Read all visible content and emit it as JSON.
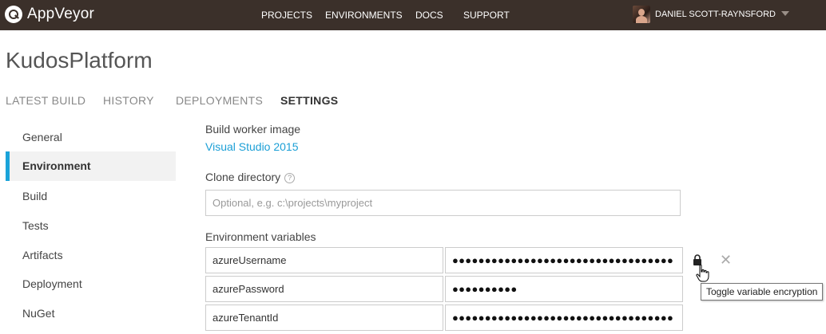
{
  "brand": {
    "name": "AppVeyor"
  },
  "nav": {
    "items": [
      "PROJECTS",
      "ENVIRONMENTS",
      "DOCS",
      "SUPPORT"
    ]
  },
  "user": {
    "name": "DANIEL SCOTT-RAYNSFORD"
  },
  "project": {
    "title": "KudosPlatform"
  },
  "tabs": [
    {
      "label": "LATEST BUILD",
      "active": false
    },
    {
      "label": "HISTORY",
      "active": false
    },
    {
      "label": "DEPLOYMENTS",
      "active": false
    },
    {
      "label": "SETTINGS",
      "active": true
    }
  ],
  "sidebar": {
    "items": [
      {
        "label": "General",
        "active": false
      },
      {
        "label": "Environment",
        "active": true
      },
      {
        "label": "Build",
        "active": false
      },
      {
        "label": "Tests",
        "active": false
      },
      {
        "label": "Artifacts",
        "active": false
      },
      {
        "label": "Deployment",
        "active": false
      },
      {
        "label": "NuGet",
        "active": false
      }
    ]
  },
  "settings": {
    "worker_image_label": "Build worker image",
    "worker_image_value": "Visual Studio 2015",
    "clone_dir_label": "Clone directory",
    "clone_dir_help": "?",
    "clone_dir_placeholder": "Optional, e.g. c:\\projects\\myproject",
    "env_vars_label": "Environment variables",
    "env_vars": [
      {
        "name": "azureUsername",
        "value": "●●●●●●●●●●●●●●●●●●●●●●●●●●●●●●●●●●"
      },
      {
        "name": "azurePassword",
        "value": "●●●●●●●●●●"
      },
      {
        "name": "azureTenantId",
        "value": "●●●●●●●●●●●●●●●●●●●●●●●●●●●●●●●●●●"
      }
    ]
  },
  "actions": {
    "lock_icon": "lock-icon",
    "remove_icon": "close-icon",
    "remove_glyph": "✕"
  },
  "tooltip": {
    "text": "Toggle variable encryption"
  },
  "colors": {
    "topbar": "#3b302a",
    "accent": "#1aa3d9",
    "link": "#1b9fd6"
  }
}
